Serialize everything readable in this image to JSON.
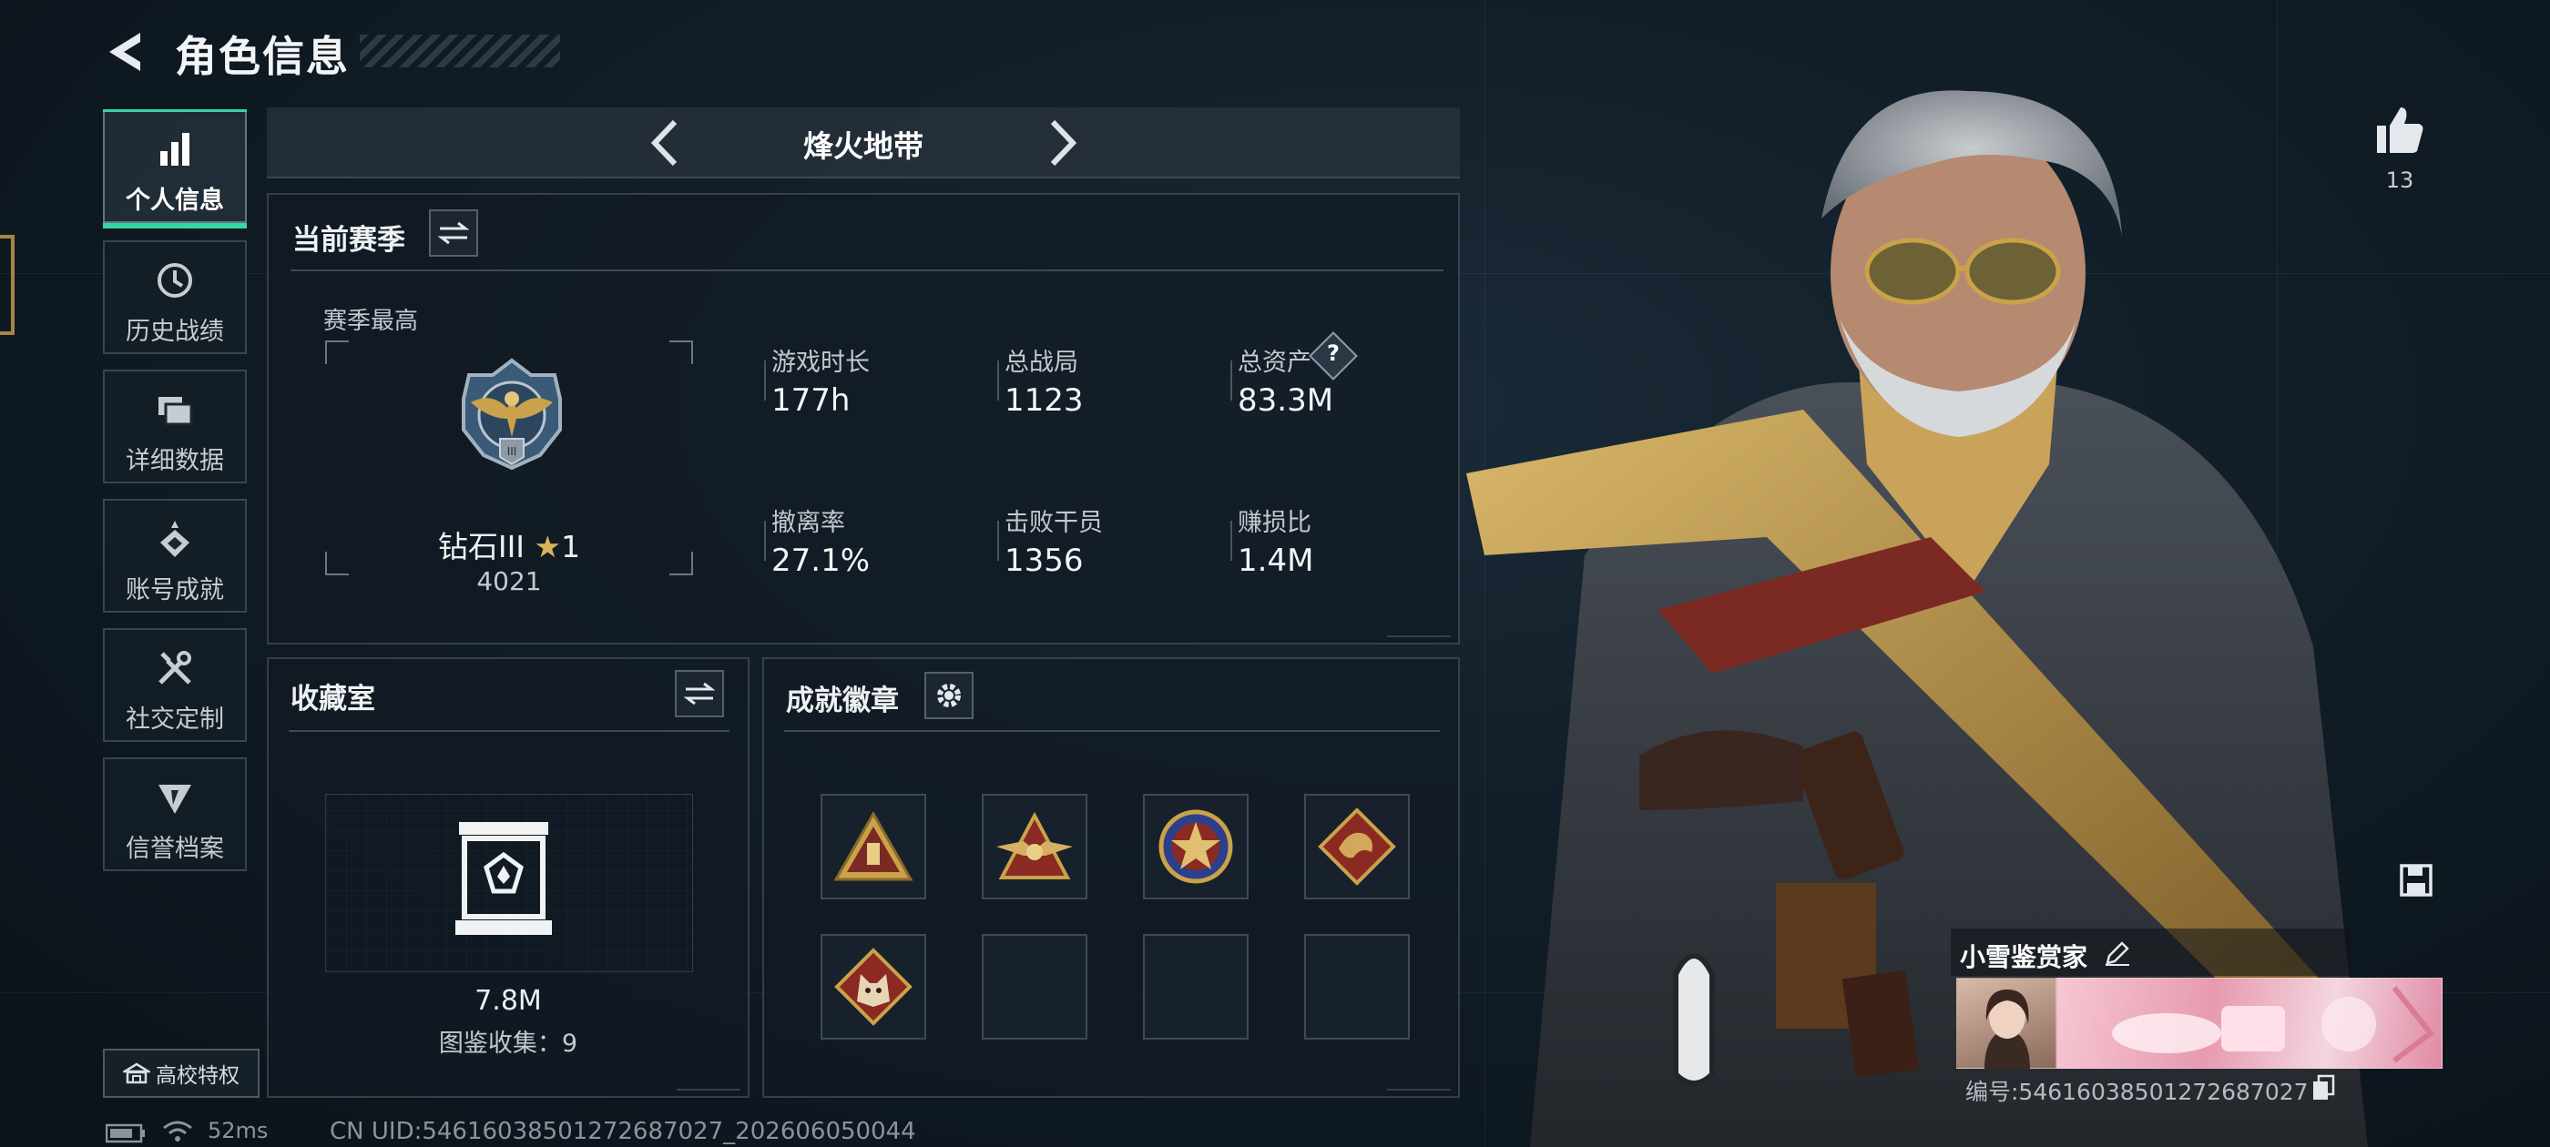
{
  "header": {
    "title": "角色信息"
  },
  "sidebar": {
    "items": [
      {
        "label": "个人信息",
        "icon": "bar-chart-icon",
        "active": true
      },
      {
        "label": "历史战绩",
        "icon": "clock-icon"
      },
      {
        "label": "详细数据",
        "icon": "cards-icon"
      },
      {
        "label": "账号成就",
        "icon": "achievement-icon"
      },
      {
        "label": "社交定制",
        "icon": "tools-icon"
      },
      {
        "label": "信誉档案",
        "icon": "shield-icon"
      }
    ],
    "campus_label": "高校特权"
  },
  "mode": {
    "title": "烽火地带"
  },
  "season": {
    "title": "当前赛季",
    "best_label": "赛季最高",
    "rank_name": "钻石III",
    "rank_stars": "1",
    "rank_score": "4021",
    "stats": [
      {
        "label": "游戏时长",
        "value": "177h"
      },
      {
        "label": "总战局",
        "value": "1123"
      },
      {
        "label": "总资产",
        "value": "83.3M",
        "help": "?"
      },
      {
        "label": "撤离率",
        "value": "27.1%"
      },
      {
        "label": "击败干员",
        "value": "1356"
      },
      {
        "label": "赚损比",
        "value": "1.4M"
      }
    ]
  },
  "collection": {
    "title": "收藏室",
    "value": "7.8M",
    "count_text": "图鉴收集：9"
  },
  "achievements": {
    "title": "成就徽章",
    "badges": [
      "triangle-badge-icon",
      "winged-badge-icon",
      "star-badge-icon",
      "dragon-badge-icon",
      "wolf-badge-icon",
      "",
      "",
      ""
    ]
  },
  "footer": {
    "ping": "52ms",
    "uid": "CN UID:546160385012726870​27_202606050044"
  },
  "profile": {
    "likes": "13",
    "card_name": "小雪鉴赏家",
    "card_id": "编号:5461603850127268702​7"
  },
  "colors": {
    "accent": "#36d6a2",
    "gold": "#c9a24a",
    "badge_red": "#8a2a22"
  }
}
